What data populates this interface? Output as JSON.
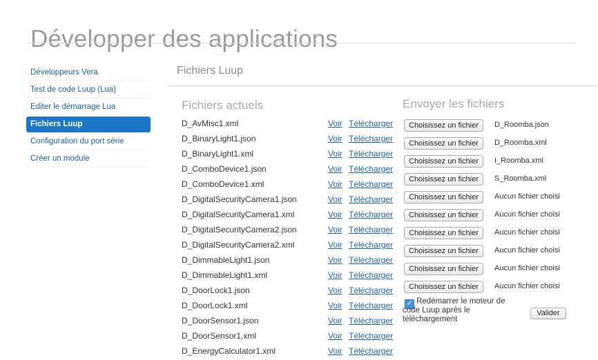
{
  "page": {
    "title": "Développer des applications"
  },
  "sidebar": {
    "items": [
      {
        "label": "Développeurs Vera"
      },
      {
        "label": "Test de code Luup (Lua)"
      },
      {
        "label": "Editer le démarrage Lua"
      },
      {
        "label": "Fichiers Luup",
        "active": true
      },
      {
        "label": "Configuration du port série"
      },
      {
        "label": "Créer un module"
      }
    ]
  },
  "section": {
    "title": "Fichiers Luup"
  },
  "current_files": {
    "title": "Fichiers actuels",
    "view_label": "Voir",
    "download_label": "Télécharger",
    "files": [
      "D_AvMisc1.xml",
      "D_BinaryLight1.json",
      "D_BinaryLight1.xml",
      "D_ComboDevice1.json",
      "D_ComboDevice1.xml",
      "D_DigitalSecurityCamera1.json",
      "D_DigitalSecurityCamera1.xml",
      "D_DigitalSecurityCamera2.json",
      "D_DigitalSecurityCamera2.xml",
      "D_DimmableLight1.json",
      "D_DimmableLight1.xml",
      "D_DoorLock1.json",
      "D_DoorLock1.xml",
      "D_DoorSensor1.json",
      "D_DoorSensor1.xml",
      "D_EnergyCalculator1.xml"
    ]
  },
  "upload": {
    "title": "Envoyer les fichiers",
    "button_label": "Choisissez un fichier",
    "slots": [
      "D_Roomba.json",
      "D_Roomba.xml",
      "I_Roomba.xml",
      "S_Roomba.xml",
      "Aucun fichier choisi",
      "Aucun fichier choisi",
      "Aucun fichier choisi",
      "Aucun fichier choisi",
      "Aucun fichier choisi",
      "Aucun fichier choisi"
    ],
    "restart_label": "Redémarrer le moteur de code Luup après le téléchargement",
    "restart_checked": true,
    "submit_label": "Valider"
  }
}
